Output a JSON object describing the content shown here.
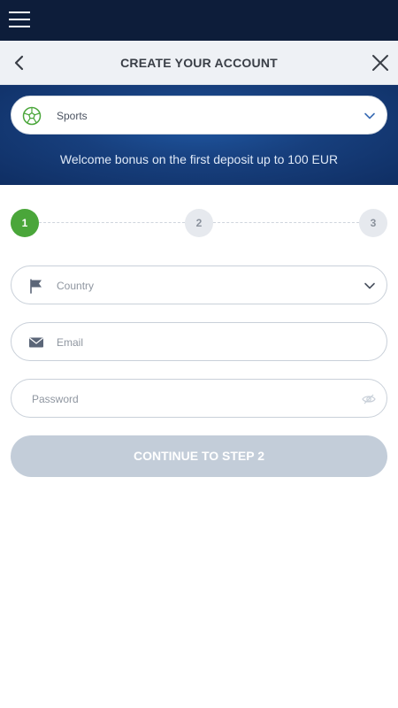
{
  "header": {
    "title": "CREATE YOUR ACCOUNT"
  },
  "banner": {
    "sport_select_value": "Sports",
    "bonus_text": "Welcome bonus on the first deposit up to 100 EUR"
  },
  "steps": [
    {
      "number": "1",
      "state": "active"
    },
    {
      "number": "2",
      "state": "inactive"
    },
    {
      "number": "3",
      "state": "inactive"
    }
  ],
  "form": {
    "country_placeholder": "Country",
    "email_placeholder": "Email",
    "password_placeholder": "Password",
    "continue_label": "CONTINUE TO STEP 2"
  },
  "colors": {
    "topbar": "#0d1d3a",
    "banner": "#173f7d",
    "step_active": "#4aa63a",
    "button_disabled": "#c3cdd9"
  },
  "icons": {
    "menu": "hamburger-icon",
    "back": "chevron-left-icon",
    "close": "close-icon",
    "sport": "soccer-ball-icon",
    "dropdown": "chevron-down-icon",
    "country": "flag-icon",
    "email": "envelope-icon",
    "password_toggle": "eye-icon"
  }
}
